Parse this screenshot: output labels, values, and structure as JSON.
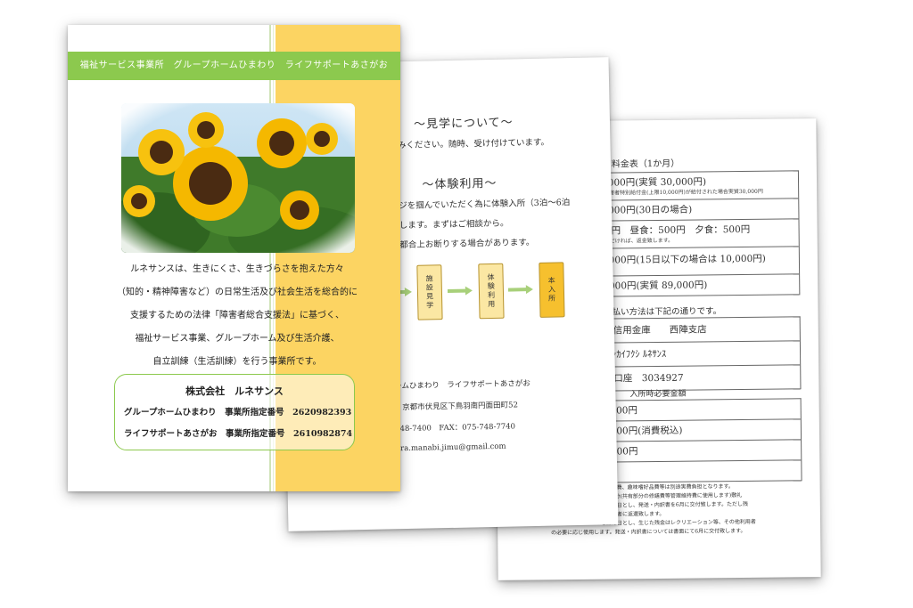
{
  "fees": {
    "title": "利用料金表（1か月）",
    "rows1": [
      {
        "text": "30,000円(実質 30,000円)",
        "small": "特定障害者特別給付金(上限10,000円)が給付された場合実質30,000円"
      },
      {
        "text": "39,000円(30日の場合)"
      },
      {
        "text": "800円　昼食：500円　夕食：500円",
        "small": "ていただければ、返金致します。"
      },
      {
        "text": "20,000円(15日以下の場合は 10,000円)"
      },
      {
        "text": "09,000円(実質 89,000円)"
      }
    ],
    "payment_intro": "お支払い方法は下記の通りです。",
    "rows2": [
      {
        "text": "京都信用金庫　　西陣支店"
      },
      {
        "text": "ﾌﾞ ｼｬｶｲﾌｸｼ ﾙﾈｻﾝｽ"
      },
      {
        "text": "普通口座　3034927"
      }
    ],
    "deposit_label": "入所時必要金額",
    "rows3": [
      {
        "text": "30,000円"
      },
      {
        "text": "13,200円(消費税込)"
      },
      {
        "text": "30,000円"
      },
      {
        "text": "実費"
      }
    ],
    "notes": [
      "、通信費、趣味嗜好品費等は別途実費負担となります。",
      "1ヶ月分(共有部分の修繕費等管理維持費に使用します)敷礼",
      "を締め日とし、発送・内訳書を6月に交付致します。ただし残",
      "し利用者に返還致します。",
      "を締め日とし、生じた残金はレクリエーション等、その他利用者",
      "の必要に応じ使用します。発送・内訳書については書面にて6月に交付致します。"
    ]
  },
  "visit": {
    "heading1": "～見学について～",
    "line1": "込みください。随時、受け付けています。",
    "heading2": "～体験利用～",
    "line2": "ージを掴んでいただく為に体験入所（3泊～6泊",
    "line3": "めします。まずはご相談から。",
    "line4": "り都合上お断りする場合があります。",
    "flow": [
      "施設見学",
      "体験利用",
      "本入所"
    ],
    "contact_arrow": ">",
    "contact1": "ームひまわり　ライフサポートあさがお",
    "contact2": "　京都市伏見区下鳥羽南円面田町52",
    "contact3": "748-7400　FAX：075-748-7740",
    "contact4": "ura.manabi.jimu@gmail.com"
  },
  "front": {
    "banner": "福祉サービス事業所　グループホームひまわり　ライフサポートあさがお",
    "intro": [
      "ルネサンスは、生きにくさ、生きづらさを抱えた方々",
      "（知的・精神障害など）の日常生活及び社会生活を総合的に",
      "支援するための法律「障害者総合支援法」に基づく、",
      "福祉サービス事業、グループホーム及び生活介護、",
      "自立訓練（生活訓練）を行う事業所です。"
    ],
    "company_name": "株式会社　ルネサンス",
    "company_line1": "グループホームひまわり　事業所指定番号　2620982393",
    "company_line2": "ライフサポートあさがお　事業所指定番号　2610982874"
  },
  "colors": {
    "banner_green": "#8cc94e",
    "panel_yellow": "#fcd462",
    "flow_light": "#fbe7a3",
    "flow_dark": "#f6c02e",
    "arrow_green": "#a8d07a"
  }
}
